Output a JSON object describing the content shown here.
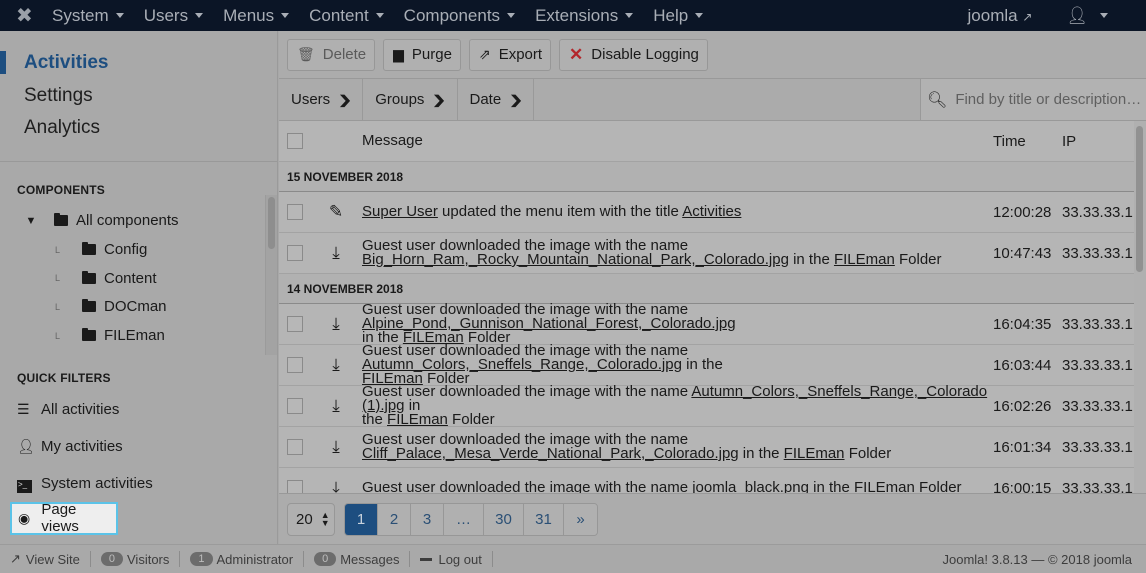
{
  "topbar": {
    "logo_icon": "joomla-logo-icon",
    "menu": [
      {
        "label": "System"
      },
      {
        "label": "Users"
      },
      {
        "label": "Menus"
      },
      {
        "label": "Content"
      },
      {
        "label": "Components"
      },
      {
        "label": "Extensions"
      },
      {
        "label": "Help"
      }
    ],
    "site_label": "joomla",
    "site_icon": "external-link-icon",
    "user_icon": "user-icon"
  },
  "sidebar": {
    "nav": [
      {
        "label": "Activities",
        "active": true
      },
      {
        "label": "Settings"
      },
      {
        "label": "Analytics"
      }
    ],
    "components_title": "COMPONENTS",
    "tree_root": "All components",
    "tree_children": [
      {
        "label": "Config"
      },
      {
        "label": "Content"
      },
      {
        "label": "DOCman"
      },
      {
        "label": "FILEman"
      }
    ],
    "quick_filters_title": "QUICK FILTERS",
    "quick_filters": [
      {
        "label": "All activities",
        "icon": "list-icon"
      },
      {
        "label": "My activities",
        "icon": "user-icon"
      },
      {
        "label": "System activities",
        "icon": "terminal-icon"
      },
      {
        "label": "Page views",
        "icon": "eye-icon",
        "selected": true
      }
    ]
  },
  "toolbar": {
    "delete_label": "Delete",
    "purge_label": "Purge",
    "export_label": "Export",
    "disable_label": "Disable Logging",
    "accent_red": "#c0262d"
  },
  "filters": {
    "users_label": "Users",
    "groups_label": "Groups",
    "date_label": "Date",
    "search_placeholder": "Find by title or description…"
  },
  "table": {
    "headers": {
      "message": "Message",
      "time": "Time",
      "ip": "IP"
    },
    "groups": [
      {
        "date": "15 NOVEMBER 2018",
        "rows": [
          {
            "icon": "pencil-icon",
            "parts": [
              {
                "t": "Super User",
                "u": true
              },
              {
                "t": " updated the menu item with the title "
              },
              {
                "t": "Activities",
                "u": true
              }
            ],
            "time": "12:00:28",
            "ip": "33.33.33.1"
          },
          {
            "icon": "download-icon",
            "parts": [
              {
                "t": "Guest user downloaded the image with the name "
              },
              {
                "br": true
              },
              {
                "t": "Big_Horn_Ram,_Rocky_Mountain_National_Park,_Colorado.jpg",
                "u": true
              },
              {
                "t": " in the "
              },
              {
                "t": "FILEman",
                "u": true
              },
              {
                "t": " Folder"
              }
            ],
            "time": "10:47:43",
            "ip": "33.33.33.1"
          }
        ]
      },
      {
        "date": "14 NOVEMBER 2018",
        "rows": [
          {
            "icon": "download-icon",
            "parts": [
              {
                "t": "Guest user downloaded the image with the name "
              },
              {
                "t": "Alpine_Pond,_Gunnison_National_Forest,_Colorado.jpg",
                "u": true
              },
              {
                "br": true
              },
              {
                "t": "in the "
              },
              {
                "t": "FILEman",
                "u": true
              },
              {
                "t": " Folder"
              }
            ],
            "time": "16:04:35",
            "ip": "33.33.33.1"
          },
          {
            "icon": "download-icon",
            "parts": [
              {
                "t": "Guest user downloaded the image with the name "
              },
              {
                "t": "Autumn_Colors,_Sneffels_Range,_Colorado.jpg",
                "u": true
              },
              {
                "t": " in the"
              },
              {
                "br": true
              },
              {
                "t": "FILEman",
                "u": true
              },
              {
                "t": " Folder"
              }
            ],
            "time": "16:03:44",
            "ip": "33.33.33.1"
          },
          {
            "icon": "download-icon",
            "parts": [
              {
                "t": "Guest user downloaded the image with the name "
              },
              {
                "t": "Autumn_Colors,_Sneffels_Range,_Colorado (1).jpg",
                "u": true
              },
              {
                "t": " in"
              },
              {
                "br": true
              },
              {
                "t": "the "
              },
              {
                "t": "FILEman",
                "u": true
              },
              {
                "t": " Folder"
              }
            ],
            "time": "16:02:26",
            "ip": "33.33.33.1"
          },
          {
            "icon": "download-icon",
            "parts": [
              {
                "t": "Guest user downloaded the image with the name "
              },
              {
                "br": true
              },
              {
                "t": "Cliff_Palace,_Mesa_Verde_National_Park,_Colorado.jpg",
                "u": true
              },
              {
                "t": " in the "
              },
              {
                "t": "FILEman",
                "u": true
              },
              {
                "t": " Folder"
              }
            ],
            "time": "16:01:34",
            "ip": "33.33.33.1"
          },
          {
            "icon": "download-icon",
            "parts": [
              {
                "t": "Guest user downloaded the image with the name "
              },
              {
                "t": "joomla_black.png",
                "u": true
              },
              {
                "t": " in the "
              },
              {
                "t": "FILEman",
                "u": true
              },
              {
                "t": " Folder"
              }
            ],
            "time": "16:00:15",
            "ip": "33.33.33.1"
          }
        ]
      }
    ]
  },
  "pagination": {
    "limit": "20",
    "pages": [
      {
        "label": "1",
        "current": true
      },
      {
        "label": "2"
      },
      {
        "label": "3"
      },
      {
        "label": "…"
      },
      {
        "label": "30"
      },
      {
        "label": "31"
      },
      {
        "label": "»"
      }
    ]
  },
  "footer": {
    "view_site": "View Site",
    "visitors_count": "0",
    "visitors_label": "Visitors",
    "admin_count": "1",
    "admin_label": "Administrator",
    "messages_count": "0",
    "messages_label": "Messages",
    "logout_label": "Log out",
    "version": "Joomla! 3.8.13  —  © 2018 joomla"
  },
  "colors": {
    "brand_blue": "#1d4e80",
    "topbar_bg": "#0b1526",
    "highlight_border": "#5bc3e8"
  }
}
